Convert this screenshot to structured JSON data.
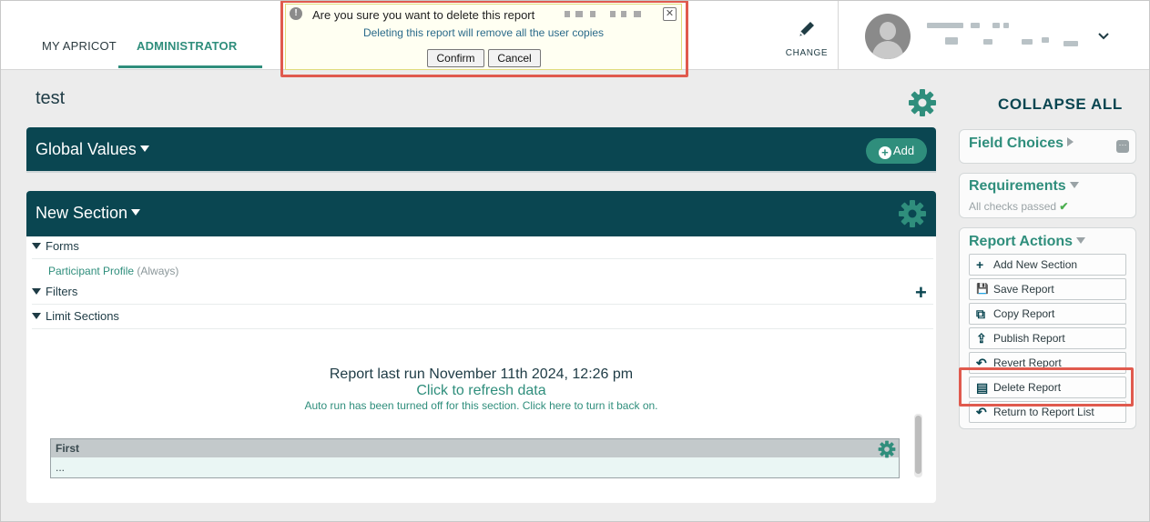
{
  "nav": {
    "tabs": [
      {
        "label": "MY APRICOT"
      },
      {
        "label": "ADMINISTRATOR"
      }
    ],
    "change_label": "CHANGE"
  },
  "dialog": {
    "title": "Are you sure you want to delete this report",
    "subtitle": "Deleting this report will remove all the user copies",
    "confirm_label": "Confirm",
    "cancel_label": "Cancel",
    "close_glyph": "✕",
    "alert_glyph": "!"
  },
  "page": {
    "title": "test"
  },
  "global_values": {
    "title": "Global Values",
    "add_label": "Add",
    "add_glyph": "+"
  },
  "section": {
    "title": "New Section",
    "tree": [
      {
        "label": "Forms"
      },
      {
        "label": "Filters"
      },
      {
        "label": "Limit Sections"
      }
    ],
    "form_link": "Participant Profile",
    "form_link_note": "(Always)",
    "filters_add_glyph": "+",
    "last_run": "Report last run November 11th 2024, 12:26 pm",
    "refresh": "Click to refresh data",
    "auto_run": "Auto run has been turned off for this section. Click here to turn it back on.",
    "table": {
      "header": "First",
      "cell": "..."
    }
  },
  "sidebar": {
    "collapse_all": "COLLAPSE ALL",
    "field_choices": {
      "title": "Field Choices",
      "icon_glyph": "···"
    },
    "requirements": {
      "title": "Requirements",
      "status": "All checks passed",
      "check_glyph": "✔"
    },
    "report_actions": {
      "title": "Report Actions",
      "items": [
        {
          "label": "Add New Section",
          "icon": "plus-icon",
          "glyph": "+"
        },
        {
          "label": "Save Report",
          "icon": "save-icon",
          "glyph": "💾"
        },
        {
          "label": "Copy Report",
          "icon": "copy-icon",
          "glyph": "⧉"
        },
        {
          "label": "Publish Report",
          "icon": "upload-icon",
          "glyph": "⇪"
        },
        {
          "label": "Revert Report",
          "icon": "undo-icon",
          "glyph": "↶"
        },
        {
          "label": "Delete Report",
          "icon": "archive-icon",
          "glyph": "▤"
        },
        {
          "label": "Return to Report List",
          "icon": "return-icon",
          "glyph": "↶"
        }
      ]
    }
  },
  "colors": {
    "brand_dark": "#0a4651",
    "brand_green": "#2f8e7c",
    "highlight": "#e05a4e"
  }
}
